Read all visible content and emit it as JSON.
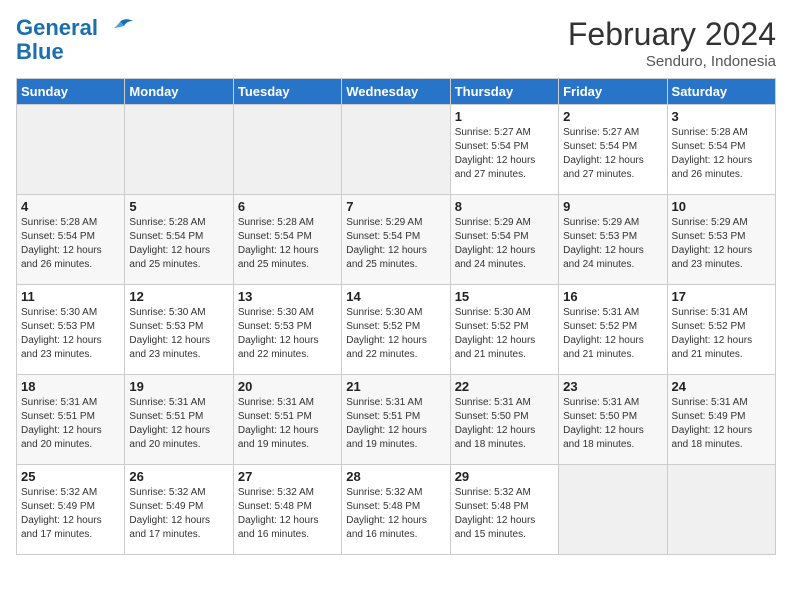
{
  "logo": {
    "line1": "General",
    "line2": "Blue"
  },
  "title": "February 2024",
  "subtitle": "Senduro, Indonesia",
  "weekdays": [
    "Sunday",
    "Monday",
    "Tuesday",
    "Wednesday",
    "Thursday",
    "Friday",
    "Saturday"
  ],
  "weeks": [
    [
      {
        "day": "",
        "info": ""
      },
      {
        "day": "",
        "info": ""
      },
      {
        "day": "",
        "info": ""
      },
      {
        "day": "",
        "info": ""
      },
      {
        "day": "1",
        "info": "Sunrise: 5:27 AM\nSunset: 5:54 PM\nDaylight: 12 hours\nand 27 minutes."
      },
      {
        "day": "2",
        "info": "Sunrise: 5:27 AM\nSunset: 5:54 PM\nDaylight: 12 hours\nand 27 minutes."
      },
      {
        "day": "3",
        "info": "Sunrise: 5:28 AM\nSunset: 5:54 PM\nDaylight: 12 hours\nand 26 minutes."
      }
    ],
    [
      {
        "day": "4",
        "info": "Sunrise: 5:28 AM\nSunset: 5:54 PM\nDaylight: 12 hours\nand 26 minutes."
      },
      {
        "day": "5",
        "info": "Sunrise: 5:28 AM\nSunset: 5:54 PM\nDaylight: 12 hours\nand 25 minutes."
      },
      {
        "day": "6",
        "info": "Sunrise: 5:28 AM\nSunset: 5:54 PM\nDaylight: 12 hours\nand 25 minutes."
      },
      {
        "day": "7",
        "info": "Sunrise: 5:29 AM\nSunset: 5:54 PM\nDaylight: 12 hours\nand 25 minutes."
      },
      {
        "day": "8",
        "info": "Sunrise: 5:29 AM\nSunset: 5:54 PM\nDaylight: 12 hours\nand 24 minutes."
      },
      {
        "day": "9",
        "info": "Sunrise: 5:29 AM\nSunset: 5:53 PM\nDaylight: 12 hours\nand 24 minutes."
      },
      {
        "day": "10",
        "info": "Sunrise: 5:29 AM\nSunset: 5:53 PM\nDaylight: 12 hours\nand 23 minutes."
      }
    ],
    [
      {
        "day": "11",
        "info": "Sunrise: 5:30 AM\nSunset: 5:53 PM\nDaylight: 12 hours\nand 23 minutes."
      },
      {
        "day": "12",
        "info": "Sunrise: 5:30 AM\nSunset: 5:53 PM\nDaylight: 12 hours\nand 23 minutes."
      },
      {
        "day": "13",
        "info": "Sunrise: 5:30 AM\nSunset: 5:53 PM\nDaylight: 12 hours\nand 22 minutes."
      },
      {
        "day": "14",
        "info": "Sunrise: 5:30 AM\nSunset: 5:52 PM\nDaylight: 12 hours\nand 22 minutes."
      },
      {
        "day": "15",
        "info": "Sunrise: 5:30 AM\nSunset: 5:52 PM\nDaylight: 12 hours\nand 21 minutes."
      },
      {
        "day": "16",
        "info": "Sunrise: 5:31 AM\nSunset: 5:52 PM\nDaylight: 12 hours\nand 21 minutes."
      },
      {
        "day": "17",
        "info": "Sunrise: 5:31 AM\nSunset: 5:52 PM\nDaylight: 12 hours\nand 21 minutes."
      }
    ],
    [
      {
        "day": "18",
        "info": "Sunrise: 5:31 AM\nSunset: 5:51 PM\nDaylight: 12 hours\nand 20 minutes."
      },
      {
        "day": "19",
        "info": "Sunrise: 5:31 AM\nSunset: 5:51 PM\nDaylight: 12 hours\nand 20 minutes."
      },
      {
        "day": "20",
        "info": "Sunrise: 5:31 AM\nSunset: 5:51 PM\nDaylight: 12 hours\nand 19 minutes."
      },
      {
        "day": "21",
        "info": "Sunrise: 5:31 AM\nSunset: 5:51 PM\nDaylight: 12 hours\nand 19 minutes."
      },
      {
        "day": "22",
        "info": "Sunrise: 5:31 AM\nSunset: 5:50 PM\nDaylight: 12 hours\nand 18 minutes."
      },
      {
        "day": "23",
        "info": "Sunrise: 5:31 AM\nSunset: 5:50 PM\nDaylight: 12 hours\nand 18 minutes."
      },
      {
        "day": "24",
        "info": "Sunrise: 5:31 AM\nSunset: 5:49 PM\nDaylight: 12 hours\nand 18 minutes."
      }
    ],
    [
      {
        "day": "25",
        "info": "Sunrise: 5:32 AM\nSunset: 5:49 PM\nDaylight: 12 hours\nand 17 minutes."
      },
      {
        "day": "26",
        "info": "Sunrise: 5:32 AM\nSunset: 5:49 PM\nDaylight: 12 hours\nand 17 minutes."
      },
      {
        "day": "27",
        "info": "Sunrise: 5:32 AM\nSunset: 5:48 PM\nDaylight: 12 hours\nand 16 minutes."
      },
      {
        "day": "28",
        "info": "Sunrise: 5:32 AM\nSunset: 5:48 PM\nDaylight: 12 hours\nand 16 minutes."
      },
      {
        "day": "29",
        "info": "Sunrise: 5:32 AM\nSunset: 5:48 PM\nDaylight: 12 hours\nand 15 minutes."
      },
      {
        "day": "",
        "info": ""
      },
      {
        "day": "",
        "info": ""
      }
    ]
  ]
}
